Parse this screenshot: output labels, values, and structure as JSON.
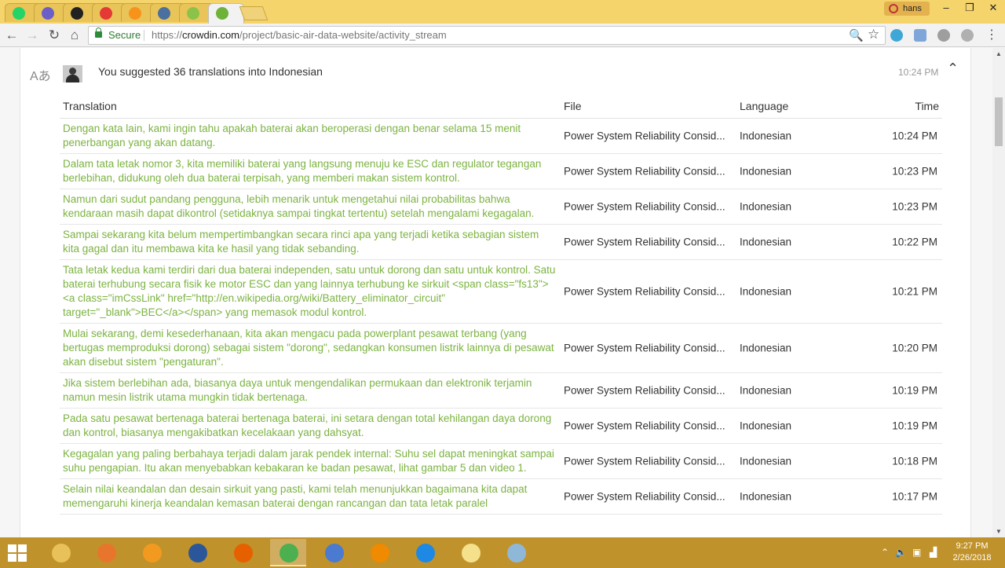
{
  "browser": {
    "tabs": [
      {
        "icon": "whatsapp-icon",
        "color": "#25d366"
      },
      {
        "icon": "browser-icon",
        "color": "#6b5fc7"
      },
      {
        "icon": "github-icon",
        "color": "#222222"
      },
      {
        "icon": "youtube-icon",
        "color": "#e53935"
      },
      {
        "icon": "bitcoin-icon",
        "color": "#f7931a"
      },
      {
        "icon": "steemit-icon",
        "color": "#4b6f9e"
      },
      {
        "icon": "android-icon",
        "color": "#8bc34a"
      },
      {
        "icon": "crowdin-icon",
        "color": "#6fb23a"
      }
    ],
    "profile_name": "hans",
    "window_controls": {
      "minimize": "–",
      "maximize": "❐",
      "close": "✕"
    },
    "nav": {
      "back": "←",
      "forward": "→",
      "reload": "↻",
      "home": "⌂"
    },
    "secure_label": "Secure",
    "url_scheme": "https://",
    "url_host": "crowdin.com",
    "url_path": "/project/basic-air-data-website/activity_stream",
    "zoom_icon": "🔍",
    "star_icon": "☆"
  },
  "activity": {
    "headline": "You suggested 36 translations into Indonesian",
    "time": "10:24 PM",
    "collapse_icon": "⌃",
    "translate_icon": "Aあ",
    "columns": {
      "translation": "Translation",
      "file": "File",
      "language": "Language",
      "time": "Time"
    },
    "rows": [
      {
        "translation": "Dengan kata lain, kami ingin tahu apakah baterai akan beroperasi dengan benar selama 15 menit penerbangan yang akan datang.",
        "file": "Power System Reliability Consid...",
        "language": "Indonesian",
        "time": "10:24 PM"
      },
      {
        "translation": "Dalam tata letak nomor 3, kita memiliki baterai yang langsung menuju ke ESC dan regulator tegangan berlebihan, didukung oleh dua baterai terpisah, yang memberi makan sistem kontrol.",
        "file": "Power System Reliability Consid...",
        "language": "Indonesian",
        "time": "10:23 PM"
      },
      {
        "translation": "Namun dari sudut pandang pengguna, lebih menarik untuk mengetahui nilai probabilitas bahwa kendaraan masih dapat dikontrol (setidaknya sampai tingkat tertentu) setelah mengalami kegagalan.",
        "file": "Power System Reliability Consid...",
        "language": "Indonesian",
        "time": "10:23 PM"
      },
      {
        "translation": "Sampai sekarang kita belum mempertimbangkan secara rinci apa yang terjadi ketika sebagian sistem kita gagal dan itu membawa kita ke hasil yang tidak sebanding.",
        "file": "Power System Reliability Consid...",
        "language": "Indonesian",
        "time": "10:22 PM"
      },
      {
        "translation": "Tata letak kedua kami terdiri dari dua baterai independen, satu untuk dorong dan satu untuk kontrol.  Satu baterai terhubung secara fisik ke motor ESC dan yang lainnya terhubung ke sirkuit <span class=\"fs13\"><a class=\"imCssLink\" href=\"http://en.wikipedia.org/wiki/Battery_eliminator_circuit\" target=\"_blank\">BEC</a></span> yang memasok modul kontrol.",
        "file": "Power System Reliability Consid...",
        "language": "Indonesian",
        "time": "10:21 PM"
      },
      {
        "translation": "Mulai sekarang, demi kesederhanaan, kita akan mengacu pada powerplant pesawat terbang (yang bertugas memproduksi dorong) sebagai sistem \"dorong\", sedangkan konsumen listrik lainnya di pesawat akan disebut sistem \"pengaturan\".",
        "file": "Power System Reliability Consid...",
        "language": "Indonesian",
        "time": "10:20 PM"
      },
      {
        "translation": "Jika sistem berlebihan ada, biasanya daya untuk mengendalikan permukaan dan elektronik terjamin namun mesin listrik utama mungkin tidak bertenaga.",
        "file": "Power System Reliability Consid...",
        "language": "Indonesian",
        "time": "10:19 PM"
      },
      {
        "translation": "Pada satu pesawat bertenaga baterai bertenaga baterai, ini setara dengan total kehilangan daya dorong dan kontrol, biasanya mengakibatkan kecelakaan yang dahsyat.",
        "file": "Power System Reliability Consid...",
        "language": "Indonesian",
        "time": "10:19 PM"
      },
      {
        "translation": "Kegagalan yang paling berbahaya terjadi dalam jarak pendek internal: Suhu sel dapat meningkat sampai suhu pengapian. Itu akan menyebabkan kebakaran ke badan pesawat, lihat gambar 5 dan video 1.",
        "file": "Power System Reliability Consid...",
        "language": "Indonesian",
        "time": "10:18 PM"
      },
      {
        "translation": "Selain nilai keandalan dan desain sirkuit yang pasti, kami telah menunjukkan bagaimana kita dapat memengaruhi kinerja keandalan kemasan baterai dengan rancangan dan tata letak paralel",
        "file": "Power System Reliability Consid...",
        "language": "Indonesian",
        "time": "10:17 PM"
      }
    ]
  },
  "taskbar": {
    "apps": [
      {
        "name": "file-explorer",
        "color": "#e8c15a"
      },
      {
        "name": "media-player",
        "color": "#e8752c"
      },
      {
        "name": "firefox-nightly",
        "color": "#f29a1f"
      },
      {
        "name": "word",
        "color": "#2b579a"
      },
      {
        "name": "firefox",
        "color": "#e66000"
      },
      {
        "name": "chrome",
        "color": "#4caf50"
      },
      {
        "name": "chromium",
        "color": "#4a7bd0"
      },
      {
        "name": "vlc",
        "color": "#f08a00"
      },
      {
        "name": "vpn",
        "color": "#1e88e5"
      },
      {
        "name": "notes",
        "color": "#f5e08c"
      },
      {
        "name": "paint",
        "color": "#8fb8d8"
      }
    ],
    "clock_time": "9:27 PM",
    "clock_date": "2/26/2018"
  }
}
